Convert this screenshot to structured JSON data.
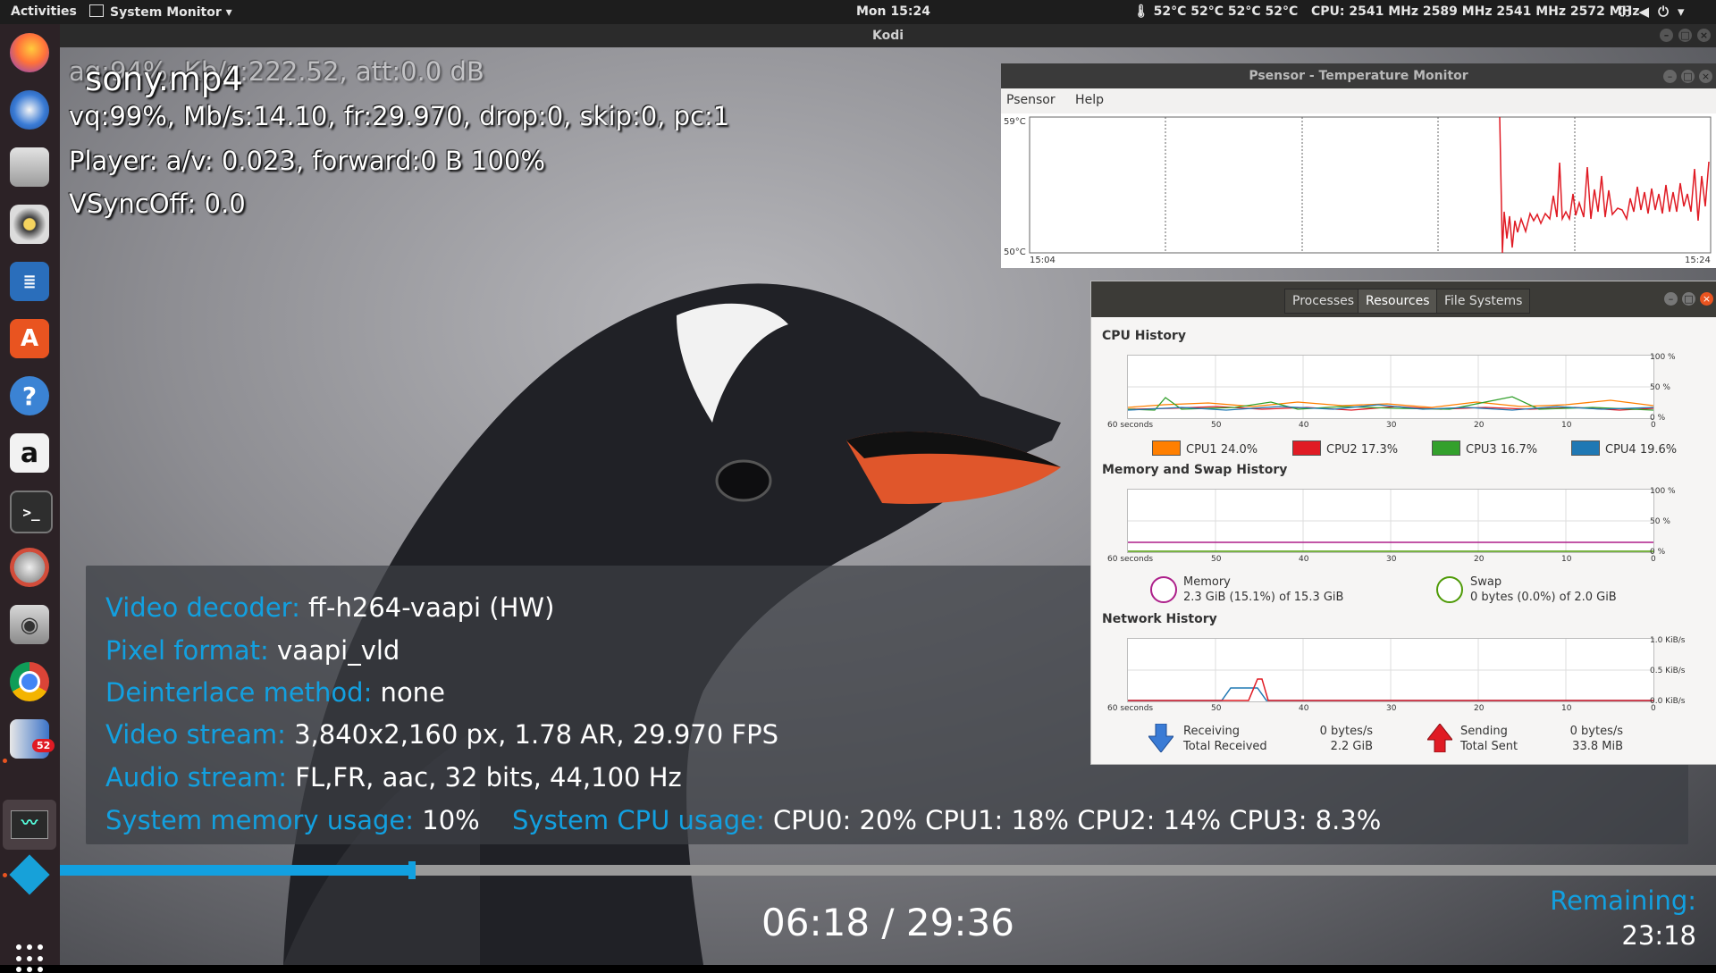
{
  "topbar": {
    "activities": "Activities",
    "app_menu": "System Monitor ▾",
    "clock": "Mon 15:24",
    "temps": "🌡 52°C 52°C 52°C 52°C",
    "cpu_freq": "CPU: 2541 MHz 2589 MHz 2541 MHz 2572 MHz"
  },
  "dock": {
    "items": [
      "firefox-icon",
      "thunderbird-icon",
      "files-icon",
      "rhythmbox-icon",
      "writer-icon",
      "software-center-icon",
      "help-icon",
      "amazon-icon",
      "terminal-icon",
      "settings-icon",
      "screenshot-icon",
      "chrome-icon",
      "app-icon",
      "system-monitor-icon",
      "kodi-icon"
    ],
    "badge": "52"
  },
  "kodi": {
    "title": "Kodi",
    "osd": {
      "aq": "aq:94%, Kb/s:222.52, att:0.0 dB",
      "file": "sony.mp4",
      "vq": "vq:99%, Mb/s:14.10, fr:29.970, drop:0, skip:0, pc:1",
      "player": "Player: a/v: 0.023,  forward:0 B 100%",
      "vsync": "VSyncOff: 0.0"
    },
    "info": {
      "decoder_label": "Video decoder:",
      "decoder_value": " ff-h264-vaapi (HW)",
      "pixel_label": "Pixel format:",
      "pixel_value": " vaapi_vld",
      "deinterlace_label": "Deinterlace method:",
      "deinterlace_value": " none",
      "video_label": "Video stream:",
      "video_value": " 3,840x2,160 px, 1.78 AR, 29.970 FPS",
      "audio_label": "Audio stream:",
      "audio_value": " FL,FR, aac, 32 bits, 44,100 Hz",
      "mem_label": "System memory usage:",
      "mem_value": " 10%",
      "cpu_label": "System CPU usage:",
      "cpu_value": " CPU0:  20% CPU1:  18% CPU2:  14% CPU3: 8.3%"
    },
    "progress_fraction": 0.2128,
    "time": "06:18 / 29:36",
    "remaining_label": "Remaining:",
    "remaining_value": "23:18",
    "accent": "#12a0e0"
  },
  "psensor": {
    "title": "Psensor - Temperature Monitor",
    "menu": [
      "Psensor",
      "Help"
    ],
    "y_max": "59°C",
    "y_min": "50°C",
    "x_start": "15:04",
    "x_end": "15:24"
  },
  "sysmon": {
    "tabs": [
      "Processes",
      "Resources",
      "File Systems"
    ],
    "cpu_title": "CPU History",
    "cpu_y": [
      "100 %",
      "50 %",
      "0 %"
    ],
    "x_ticks": [
      "60 seconds",
      "50",
      "40",
      "30",
      "20",
      "10",
      "0"
    ],
    "cpu_legend": [
      {
        "label": "CPU1  24.0%",
        "color": "#ff7f00"
      },
      {
        "label": "CPU2  17.3%",
        "color": "#e01b24"
      },
      {
        "label": "CPU3  16.7%",
        "color": "#33a02c"
      },
      {
        "label": "CPU4  19.6%",
        "color": "#1f78b4"
      }
    ],
    "mem_title": "Memory and Swap History",
    "mem_y": [
      "100 %",
      "50 %",
      "0 %"
    ],
    "memory_label": "Memory",
    "memory_value": "2.3 GiB (15.1%) of 15.3 GiB",
    "swap_label": "Swap",
    "swap_value": "0 bytes (0.0%) of 2.0 GiB",
    "net_title": "Network History",
    "net_y": [
      "1.0 KiB/s",
      "0.5 KiB/s",
      "0.0 KiB/s"
    ],
    "receiving_label": "Receiving",
    "total_received_label": "Total Received",
    "receiving_value": "0 bytes/s",
    "total_received_value": "2.2 GiB",
    "sending_label": "Sending",
    "total_sent_label": "Total Sent",
    "sending_value": "0 bytes/s",
    "total_sent_value": "33.8 MiB"
  }
}
